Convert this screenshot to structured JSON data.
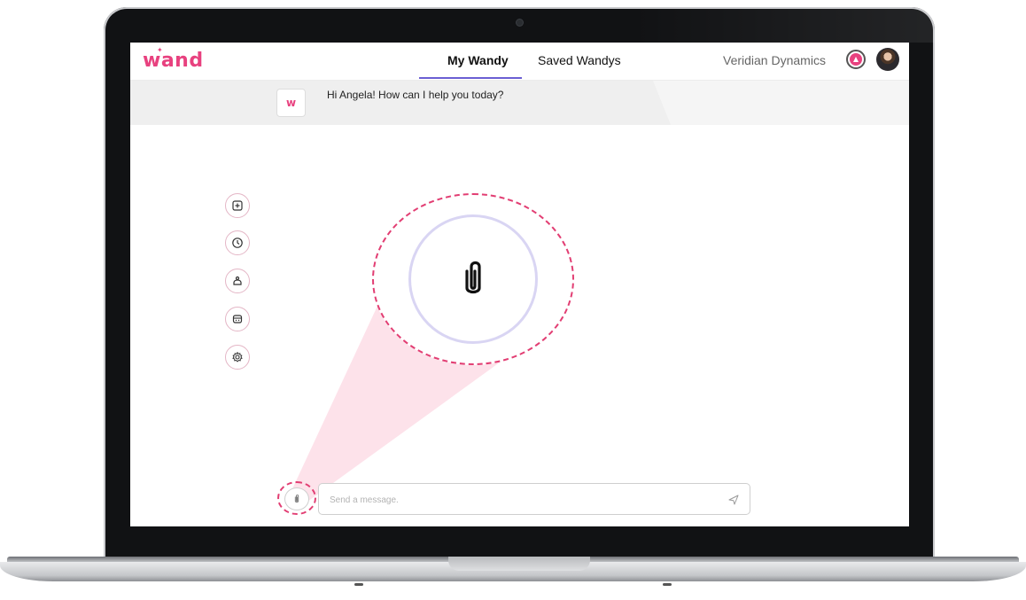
{
  "app": {
    "logo_text": "wand",
    "brand_color": "#e8417f",
    "accent_color": "#6b5fd3"
  },
  "header": {
    "tabs": [
      {
        "label": "My Wandy",
        "active": true
      },
      {
        "label": "Saved Wandys",
        "active": false
      }
    ],
    "company": "Veridian Dynamics"
  },
  "chat": {
    "bot_avatar_text": "w",
    "greeting": "Hi Angela! How can I help you today?"
  },
  "sidebar": {
    "icons": [
      "new-chat-icon",
      "history-icon",
      "wand-icon",
      "bot-icon",
      "settings-icon"
    ]
  },
  "highlight": {
    "icon": "paperclip-icon"
  },
  "composer": {
    "placeholder": "Send a message.",
    "attach_icon": "paperclip-icon",
    "send_icon": "send-icon"
  }
}
